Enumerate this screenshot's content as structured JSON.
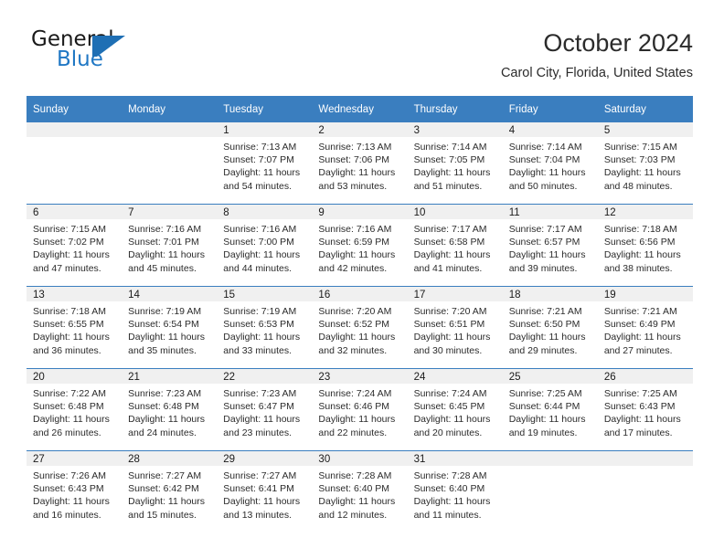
{
  "logo": {
    "word1": "General",
    "word2": "Blue",
    "mark_name": "blue-triangle-logo-mark",
    "accent_color": "#1f6fb4"
  },
  "header": {
    "title": "October 2024",
    "location": "Carol City, Florida, United States"
  },
  "theme": {
    "header_blue": "#3a7ebf",
    "daynum_band": "#f0f0f0",
    "text": "#2b2b2b"
  },
  "weekday_headers": [
    "Sunday",
    "Monday",
    "Tuesday",
    "Wednesday",
    "Thursday",
    "Friday",
    "Saturday"
  ],
  "weeks": [
    [
      {
        "day": "",
        "sunrise": "",
        "sunset": "",
        "daylight1": "",
        "daylight2": ""
      },
      {
        "day": "",
        "sunrise": "",
        "sunset": "",
        "daylight1": "",
        "daylight2": ""
      },
      {
        "day": "1",
        "sunrise": "Sunrise: 7:13 AM",
        "sunset": "Sunset: 7:07 PM",
        "daylight1": "Daylight: 11 hours",
        "daylight2": "and 54 minutes."
      },
      {
        "day": "2",
        "sunrise": "Sunrise: 7:13 AM",
        "sunset": "Sunset: 7:06 PM",
        "daylight1": "Daylight: 11 hours",
        "daylight2": "and 53 minutes."
      },
      {
        "day": "3",
        "sunrise": "Sunrise: 7:14 AM",
        "sunset": "Sunset: 7:05 PM",
        "daylight1": "Daylight: 11 hours",
        "daylight2": "and 51 minutes."
      },
      {
        "day": "4",
        "sunrise": "Sunrise: 7:14 AM",
        "sunset": "Sunset: 7:04 PM",
        "daylight1": "Daylight: 11 hours",
        "daylight2": "and 50 minutes."
      },
      {
        "day": "5",
        "sunrise": "Sunrise: 7:15 AM",
        "sunset": "Sunset: 7:03 PM",
        "daylight1": "Daylight: 11 hours",
        "daylight2": "and 48 minutes."
      }
    ],
    [
      {
        "day": "6",
        "sunrise": "Sunrise: 7:15 AM",
        "sunset": "Sunset: 7:02 PM",
        "daylight1": "Daylight: 11 hours",
        "daylight2": "and 47 minutes."
      },
      {
        "day": "7",
        "sunrise": "Sunrise: 7:16 AM",
        "sunset": "Sunset: 7:01 PM",
        "daylight1": "Daylight: 11 hours",
        "daylight2": "and 45 minutes."
      },
      {
        "day": "8",
        "sunrise": "Sunrise: 7:16 AM",
        "sunset": "Sunset: 7:00 PM",
        "daylight1": "Daylight: 11 hours",
        "daylight2": "and 44 minutes."
      },
      {
        "day": "9",
        "sunrise": "Sunrise: 7:16 AM",
        "sunset": "Sunset: 6:59 PM",
        "daylight1": "Daylight: 11 hours",
        "daylight2": "and 42 minutes."
      },
      {
        "day": "10",
        "sunrise": "Sunrise: 7:17 AM",
        "sunset": "Sunset: 6:58 PM",
        "daylight1": "Daylight: 11 hours",
        "daylight2": "and 41 minutes."
      },
      {
        "day": "11",
        "sunrise": "Sunrise: 7:17 AM",
        "sunset": "Sunset: 6:57 PM",
        "daylight1": "Daylight: 11 hours",
        "daylight2": "and 39 minutes."
      },
      {
        "day": "12",
        "sunrise": "Sunrise: 7:18 AM",
        "sunset": "Sunset: 6:56 PM",
        "daylight1": "Daylight: 11 hours",
        "daylight2": "and 38 minutes."
      }
    ],
    [
      {
        "day": "13",
        "sunrise": "Sunrise: 7:18 AM",
        "sunset": "Sunset: 6:55 PM",
        "daylight1": "Daylight: 11 hours",
        "daylight2": "and 36 minutes."
      },
      {
        "day": "14",
        "sunrise": "Sunrise: 7:19 AM",
        "sunset": "Sunset: 6:54 PM",
        "daylight1": "Daylight: 11 hours",
        "daylight2": "and 35 minutes."
      },
      {
        "day": "15",
        "sunrise": "Sunrise: 7:19 AM",
        "sunset": "Sunset: 6:53 PM",
        "daylight1": "Daylight: 11 hours",
        "daylight2": "and 33 minutes."
      },
      {
        "day": "16",
        "sunrise": "Sunrise: 7:20 AM",
        "sunset": "Sunset: 6:52 PM",
        "daylight1": "Daylight: 11 hours",
        "daylight2": "and 32 minutes."
      },
      {
        "day": "17",
        "sunrise": "Sunrise: 7:20 AM",
        "sunset": "Sunset: 6:51 PM",
        "daylight1": "Daylight: 11 hours",
        "daylight2": "and 30 minutes."
      },
      {
        "day": "18",
        "sunrise": "Sunrise: 7:21 AM",
        "sunset": "Sunset: 6:50 PM",
        "daylight1": "Daylight: 11 hours",
        "daylight2": "and 29 minutes."
      },
      {
        "day": "19",
        "sunrise": "Sunrise: 7:21 AM",
        "sunset": "Sunset: 6:49 PM",
        "daylight1": "Daylight: 11 hours",
        "daylight2": "and 27 minutes."
      }
    ],
    [
      {
        "day": "20",
        "sunrise": "Sunrise: 7:22 AM",
        "sunset": "Sunset: 6:48 PM",
        "daylight1": "Daylight: 11 hours",
        "daylight2": "and 26 minutes."
      },
      {
        "day": "21",
        "sunrise": "Sunrise: 7:23 AM",
        "sunset": "Sunset: 6:48 PM",
        "daylight1": "Daylight: 11 hours",
        "daylight2": "and 24 minutes."
      },
      {
        "day": "22",
        "sunrise": "Sunrise: 7:23 AM",
        "sunset": "Sunset: 6:47 PM",
        "daylight1": "Daylight: 11 hours",
        "daylight2": "and 23 minutes."
      },
      {
        "day": "23",
        "sunrise": "Sunrise: 7:24 AM",
        "sunset": "Sunset: 6:46 PM",
        "daylight1": "Daylight: 11 hours",
        "daylight2": "and 22 minutes."
      },
      {
        "day": "24",
        "sunrise": "Sunrise: 7:24 AM",
        "sunset": "Sunset: 6:45 PM",
        "daylight1": "Daylight: 11 hours",
        "daylight2": "and 20 minutes."
      },
      {
        "day": "25",
        "sunrise": "Sunrise: 7:25 AM",
        "sunset": "Sunset: 6:44 PM",
        "daylight1": "Daylight: 11 hours",
        "daylight2": "and 19 minutes."
      },
      {
        "day": "26",
        "sunrise": "Sunrise: 7:25 AM",
        "sunset": "Sunset: 6:43 PM",
        "daylight1": "Daylight: 11 hours",
        "daylight2": "and 17 minutes."
      }
    ],
    [
      {
        "day": "27",
        "sunrise": "Sunrise: 7:26 AM",
        "sunset": "Sunset: 6:43 PM",
        "daylight1": "Daylight: 11 hours",
        "daylight2": "and 16 minutes."
      },
      {
        "day": "28",
        "sunrise": "Sunrise: 7:27 AM",
        "sunset": "Sunset: 6:42 PM",
        "daylight1": "Daylight: 11 hours",
        "daylight2": "and 15 minutes."
      },
      {
        "day": "29",
        "sunrise": "Sunrise: 7:27 AM",
        "sunset": "Sunset: 6:41 PM",
        "daylight1": "Daylight: 11 hours",
        "daylight2": "and 13 minutes."
      },
      {
        "day": "30",
        "sunrise": "Sunrise: 7:28 AM",
        "sunset": "Sunset: 6:40 PM",
        "daylight1": "Daylight: 11 hours",
        "daylight2": "and 12 minutes."
      },
      {
        "day": "31",
        "sunrise": "Sunrise: 7:28 AM",
        "sunset": "Sunset: 6:40 PM",
        "daylight1": "Daylight: 11 hours",
        "daylight2": "and 11 minutes."
      },
      {
        "day": "",
        "sunrise": "",
        "sunset": "",
        "daylight1": "",
        "daylight2": ""
      },
      {
        "day": "",
        "sunrise": "",
        "sunset": "",
        "daylight1": "",
        "daylight2": ""
      }
    ]
  ]
}
